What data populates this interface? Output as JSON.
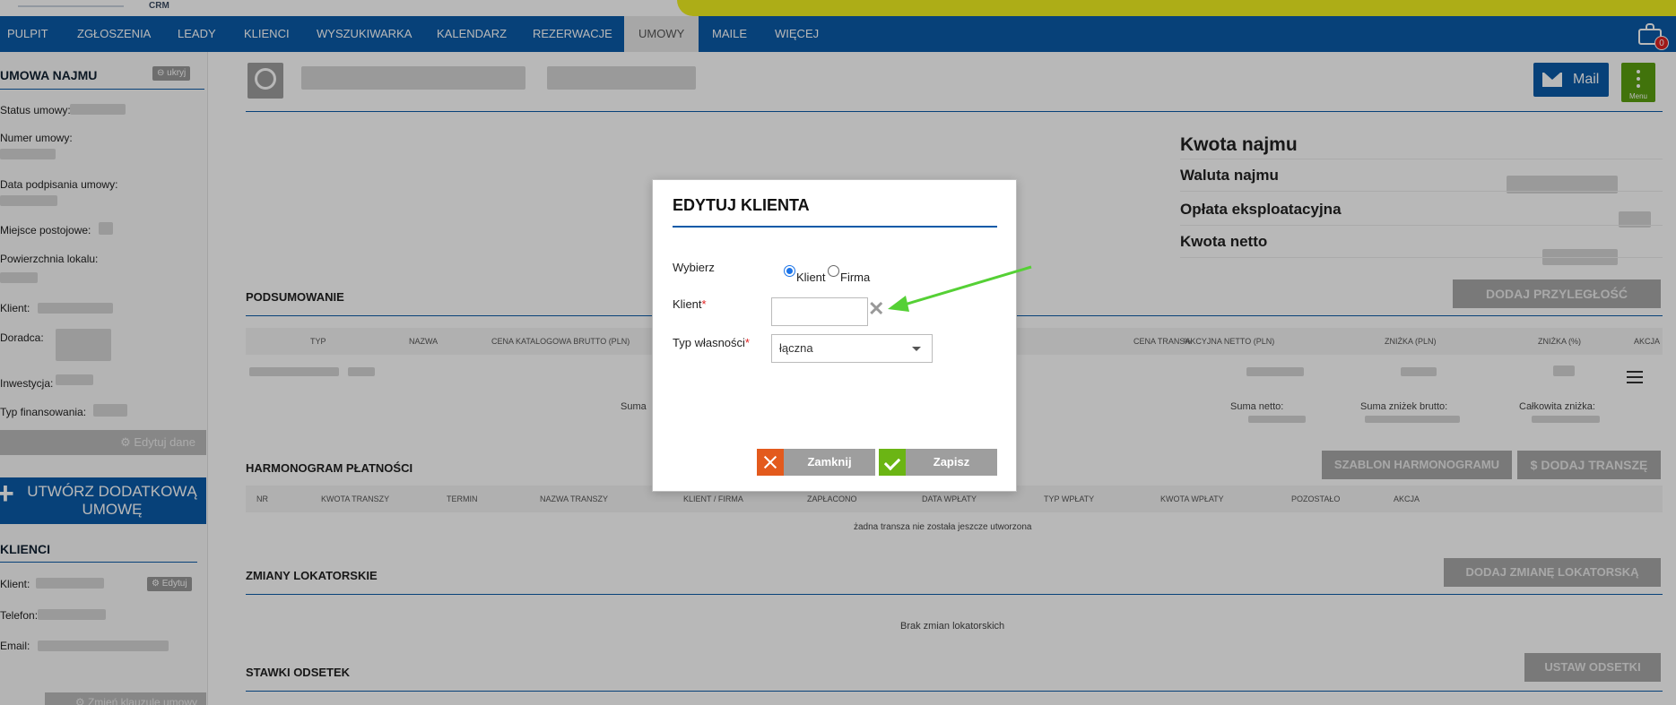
{
  "header": {
    "crm_label": "CRM"
  },
  "nav": {
    "items": [
      "PULPIT",
      "ZGŁOSZENIA",
      "LEADY",
      "KLIENCI",
      "WYSZUKIWARKA",
      "KALENDARZ",
      "REZERWACJE",
      "UMOWY",
      "MAILE",
      "WIĘCEJ"
    ],
    "active": "UMOWY",
    "cart_badge": "0"
  },
  "sidebar": {
    "contract_title": "UMOWA NAJMU",
    "hide_label": "⊖ ukryj",
    "fields": [
      "Status umowy:",
      "Numer umowy:",
      "Data podpisania umowy:",
      "Miejsce postojowe:",
      "Powierzchnia lokalu:",
      "Klient:",
      "Doradca:",
      "Inwestycja:",
      "Typ finansowania:"
    ],
    "edit_data": "⚙ Edytuj dane",
    "create_btn": "UTWÓRZ DODATKOWĄ UMOWĘ",
    "clients_title": "KLIENCI",
    "client_fields": [
      "Klient:",
      "Telefon:",
      "Email:"
    ],
    "client_edit": "⚙ Edytuj",
    "bottom_btn": "⚙ Zmień klauzulę umowy"
  },
  "main": {
    "mail_btn": "Mail",
    "menu_label": "Menu",
    "kv": [
      {
        "label": "Kwota najmu"
      },
      {
        "label": "Waluta najmu"
      },
      {
        "label": "Opłata eksploatacyjna"
      },
      {
        "label": "Kwota netto"
      }
    ],
    "summary": {
      "title": "PODSUMOWANIE",
      "add_btn": "DODAJ PRZYLEGŁOŚĆ",
      "columns": [
        "TYP",
        "NAZWA",
        "CENA KATALOGOWA BRUTTO (PLN)",
        "%",
        "CENA TRANSAKCYJNA NETTO (PLN)",
        "ZNIŻKA (PLN)",
        "ZNIŻKA (%)",
        "AKCJA"
      ],
      "suma_label": "Suma",
      "suma_netto": "Suma netto:",
      "suma_znizek": "Suma zniżek brutto:",
      "calkowita": "Całkowita zniżka:"
    },
    "schedule": {
      "title": "HARMONOGRAM PŁATNOŚCI",
      "template_btn": "SZABLON HARMONOGRAMU",
      "add_btn": "$ DODAJ TRANSZĘ",
      "columns": [
        "NR",
        "KWOTA TRANSZY",
        "TERMIN",
        "NAZWA TRANSZY",
        "KLIENT / FIRMA",
        "ZAPŁACONO",
        "DATA WPŁATY",
        "TYP WPŁATY",
        "KWOTA WPŁATY",
        "POZOSTAŁO",
        "AKCJA"
      ],
      "empty": "żadna transza nie została jeszcze utworzona"
    },
    "tenant_changes": {
      "title": "ZMIANY LOKATORSKIE",
      "add_btn": "DODAJ ZMIANĘ LOKATORSKĄ",
      "empty": "Brak zmian lokatorskich"
    },
    "interest": {
      "title": "STAWKI ODSETEK",
      "set_btn": "USTAW ODSETKI"
    }
  },
  "modal": {
    "title": "EDYTUJ KLIENTA",
    "choose_label": "Wybierz",
    "radio_options": [
      "Klient",
      "Firma"
    ],
    "selected": "Klient",
    "client_label": "Klient",
    "client_value": "",
    "clear_icon": "✕",
    "ownership_label": "Typ własności",
    "ownership_value": "łączna",
    "close_btn": "Zamknij",
    "save_btn": "Zapisz",
    "required_mark": "*"
  },
  "colors": {
    "primary": "#0a5aa8",
    "accent_green": "#6bb514",
    "close_orange": "#e35a1d",
    "arrow_green": "#55d035"
  }
}
